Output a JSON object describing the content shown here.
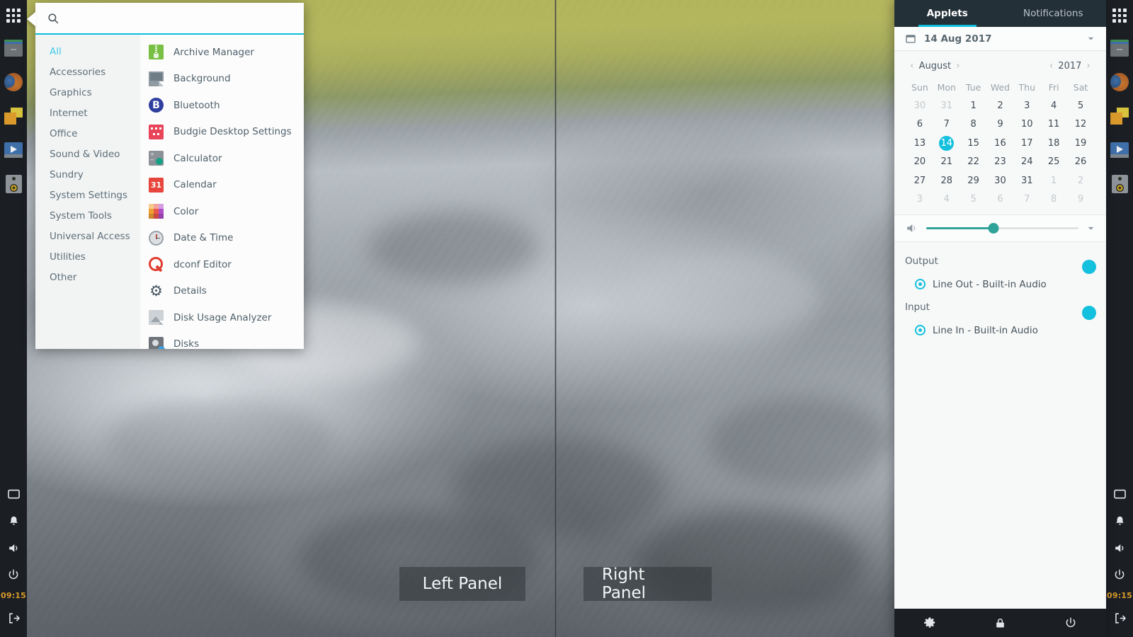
{
  "desktop": {
    "panel_labels": [
      {
        "name": "left-panel-label",
        "text": "Left Panel"
      },
      {
        "name": "right-panel-label",
        "text": "Right Panel"
      }
    ],
    "accent_color": "#0dbedc",
    "dock_background": "#1b1f24",
    "clock": "09:15"
  },
  "dock": {
    "apps": [
      {
        "name": "app-grid-icon",
        "icon": "app-grid-icon"
      },
      {
        "name": "files-icon",
        "icon": "files-icon"
      },
      {
        "name": "firefox-icon",
        "icon": "firefox-icon"
      },
      {
        "name": "notes-icon",
        "icon": "notes-icon"
      },
      {
        "name": "video-player-icon",
        "icon": "video-player-icon"
      },
      {
        "name": "audio-player-icon",
        "icon": "audio-player-icon"
      }
    ],
    "tray": [
      {
        "name": "display-icon",
        "icon": "display-icon"
      },
      {
        "name": "notification-bell-icon",
        "icon": "bell-icon"
      },
      {
        "name": "volume-icon",
        "icon": "speaker-icon"
      },
      {
        "name": "power-icon",
        "icon": "power-icon"
      }
    ],
    "clock": "09:15",
    "logout_icon": "logout-icon"
  },
  "app_menu": {
    "search": {
      "placeholder": "",
      "value": "",
      "icon": "search-icon"
    },
    "categories": [
      {
        "label": "All",
        "active": true
      },
      {
        "label": "Accessories",
        "active": false
      },
      {
        "label": "Graphics",
        "active": false
      },
      {
        "label": "Internet",
        "active": false
      },
      {
        "label": "Office",
        "active": false
      },
      {
        "label": "Sound & Video",
        "active": false
      },
      {
        "label": "Sundry",
        "active": false
      },
      {
        "label": "System Settings",
        "active": false
      },
      {
        "label": "System Tools",
        "active": false
      },
      {
        "label": "Universal Access",
        "active": false
      },
      {
        "label": "Utilities",
        "active": false
      },
      {
        "label": "Other",
        "active": false
      }
    ],
    "applications": [
      {
        "label": "Archive Manager",
        "icon": "archive-manager-icon",
        "cls": "ai-archive"
      },
      {
        "label": "Background",
        "icon": "background-icon",
        "cls": "ai-background"
      },
      {
        "label": "Bluetooth",
        "icon": "bluetooth-icon",
        "cls": "ai-bluetooth"
      },
      {
        "label": "Budgie Desktop Settings",
        "icon": "budgie-settings-icon",
        "cls": "ai-budgie"
      },
      {
        "label": "Calculator",
        "icon": "calculator-icon",
        "cls": "ai-calculator"
      },
      {
        "label": "Calendar",
        "icon": "calendar-icon",
        "cls": "ai-calendar"
      },
      {
        "label": "Color",
        "icon": "color-icon",
        "cls": "ai-color"
      },
      {
        "label": "Date & Time",
        "icon": "date-time-icon",
        "cls": "ai-datetime"
      },
      {
        "label": "dconf Editor",
        "icon": "dconf-editor-icon",
        "cls": "ai-dconf"
      },
      {
        "label": "Details",
        "icon": "details-icon",
        "cls": "ai-details"
      },
      {
        "label": "Disk Usage Analyzer",
        "icon": "disk-usage-analyzer-icon",
        "cls": "ai-disk-usage"
      },
      {
        "label": "Disks",
        "icon": "disks-icon",
        "cls": "ai-disks"
      }
    ]
  },
  "raven": {
    "tabs": [
      {
        "label": "Applets",
        "active": true
      },
      {
        "label": "Notifications",
        "active": false
      }
    ],
    "calendar_widget": {
      "header_icon": "calendar-icon",
      "header_text": "14 Aug 2017",
      "expander_icon": "chevron-down-icon",
      "month": "August",
      "year": "2017",
      "prev_month_icon": "chevron-left-icon",
      "next_month_icon": "chevron-right-icon",
      "prev_year_icon": "chevron-left-icon",
      "next_year_icon": "chevron-right-icon",
      "weekdays": [
        "Sun",
        "Mon",
        "Tue",
        "Wed",
        "Thu",
        "Fri",
        "Sat"
      ],
      "today": 14,
      "weeks": [
        [
          {
            "d": "30",
            "dim": true
          },
          {
            "d": "31",
            "dim": true
          },
          {
            "d": "1"
          },
          {
            "d": "2"
          },
          {
            "d": "3"
          },
          {
            "d": "4"
          },
          {
            "d": "5"
          }
        ],
        [
          {
            "d": "6"
          },
          {
            "d": "7"
          },
          {
            "d": "8"
          },
          {
            "d": "9"
          },
          {
            "d": "10"
          },
          {
            "d": "11"
          },
          {
            "d": "12"
          }
        ],
        [
          {
            "d": "13"
          },
          {
            "d": "14",
            "today": true
          },
          {
            "d": "15"
          },
          {
            "d": "16"
          },
          {
            "d": "17"
          },
          {
            "d": "18"
          },
          {
            "d": "19"
          }
        ],
        [
          {
            "d": "20"
          },
          {
            "d": "21"
          },
          {
            "d": "22"
          },
          {
            "d": "23"
          },
          {
            "d": "24"
          },
          {
            "d": "25"
          },
          {
            "d": "26"
          }
        ],
        [
          {
            "d": "27"
          },
          {
            "d": "28"
          },
          {
            "d": "29"
          },
          {
            "d": "30"
          },
          {
            "d": "31"
          },
          {
            "d": "1",
            "dim": true
          },
          {
            "d": "2",
            "dim": true
          }
        ],
        [
          {
            "d": "3",
            "dim": true
          },
          {
            "d": "4",
            "dim": true
          },
          {
            "d": "5",
            "dim": true
          },
          {
            "d": "6",
            "dim": true
          },
          {
            "d": "7",
            "dim": true
          },
          {
            "d": "8",
            "dim": true
          },
          {
            "d": "9",
            "dim": true
          }
        ]
      ]
    },
    "sound_widget": {
      "volume_icon": "speaker-icon",
      "volume_percent": 44,
      "expander_icon": "chevron-down-icon",
      "output": {
        "label": "Output",
        "enabled": true,
        "device": "Line Out - Built-in Audio"
      },
      "input": {
        "label": "Input",
        "enabled": true,
        "device": "Line In - Built-in Audio"
      }
    },
    "bottom_actions": [
      {
        "name": "settings-button",
        "icon": "gear-icon"
      },
      {
        "name": "lock-button",
        "icon": "lock-icon"
      },
      {
        "name": "power-button",
        "icon": "power-icon"
      }
    ]
  }
}
